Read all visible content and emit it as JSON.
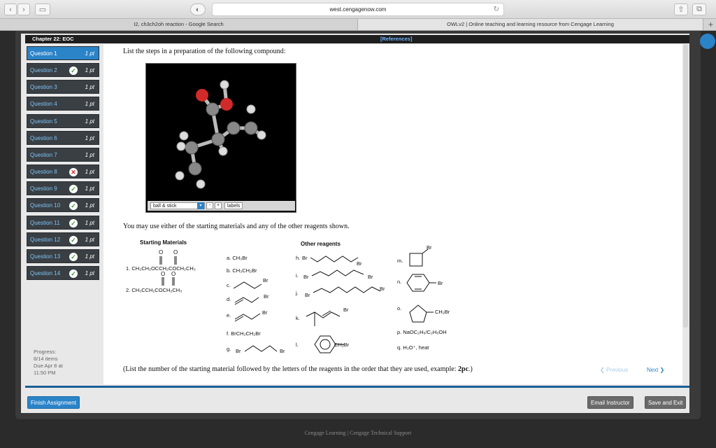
{
  "browser": {
    "url": "west.cengagenow.com",
    "tabs": [
      {
        "label": "I2, ch3ch2oh reaction - Google Search"
      },
      {
        "label": "OWLv2 | Online teaching and learning resource from Cengage Learning"
      }
    ]
  },
  "header": {
    "chapter": "Chapter 22: EOC",
    "references": "[References]"
  },
  "sidebar": {
    "questions": [
      {
        "label": "Question 1",
        "pts": "1 pt",
        "status": ""
      },
      {
        "label": "Question 2",
        "pts": "1 pt",
        "status": "✓"
      },
      {
        "label": "Question 3",
        "pts": "1 pt",
        "status": ""
      },
      {
        "label": "Question 4",
        "pts": "1 pt",
        "status": ""
      },
      {
        "label": "Question 5",
        "pts": "1 pt",
        "status": ""
      },
      {
        "label": "Question 6",
        "pts": "1 pt",
        "status": ""
      },
      {
        "label": "Question 7",
        "pts": "1 pt",
        "status": ""
      },
      {
        "label": "Question 8",
        "pts": "1 pt",
        "status": "✕"
      },
      {
        "label": "Question 9",
        "pts": "1 pt",
        "status": "✓"
      },
      {
        "label": "Question 10",
        "pts": "1 pt",
        "status": "✓"
      },
      {
        "label": "Question 11",
        "pts": "1 pt",
        "status": "✓"
      },
      {
        "label": "Question 12",
        "pts": "1 pt",
        "status": "✓"
      },
      {
        "label": "Question 13",
        "pts": "1 pt",
        "status": "✓"
      },
      {
        "label": "Question 14",
        "pts": "1 pt",
        "status": "✓"
      }
    ],
    "progress_label": "Progress:",
    "progress_value": "8/14 items",
    "due_label": "Due Apr 8 at",
    "due_time": "11:50 PM"
  },
  "question": {
    "prompt": "List the steps in a preparation of the following compound:",
    "viewer_mode": "ball & stick",
    "viewer_labels": "labels",
    "sentence": "You may use either of the starting materials and any of the other reagents shown.",
    "instructions_pre": "(List the number of the starting material followed by the letters of the reagents in the order that they are used, example: ",
    "instructions_example": "2pc",
    "instructions_post": ".)"
  },
  "reagents": {
    "starting_title": "Starting Materials",
    "other_title": "Other reagents",
    "sm1": "1. CH₃CH₂OCCH₂COCH₂CH₃",
    "sm2": "2. CH₃CCH₂COCH₂CH₃",
    "a": "a. CH₃Br",
    "b": "b. CH₃CH₂Br",
    "c": "c.",
    "d": "d.",
    "e": "e.",
    "f": "f. BrCH₂CH₂Br",
    "g": "g.",
    "h": "h.",
    "i": "i.",
    "j": "j.",
    "k": "k.",
    "l": "l.",
    "m": "m.",
    "n": "n.",
    "o": "o.",
    "p": "p. NaOC₂H₅/C₂H₅OH",
    "q": "q. H₃O⁺, heat",
    "br": "Br",
    "ch2br": "CH₂Br",
    "o_atom": "O"
  },
  "nav": {
    "previous": "Previous",
    "next": "Next"
  },
  "buttons": {
    "finish": "Finish Assignment",
    "email": "Email Instructor",
    "save": "Save and Exit"
  },
  "footer": {
    "text": "Cengage Learning  |  Cengage Technical Support"
  },
  "colors": {
    "accent": "#2b83c8",
    "ok": "#3a9a3a",
    "bad": "#d12a2a"
  }
}
